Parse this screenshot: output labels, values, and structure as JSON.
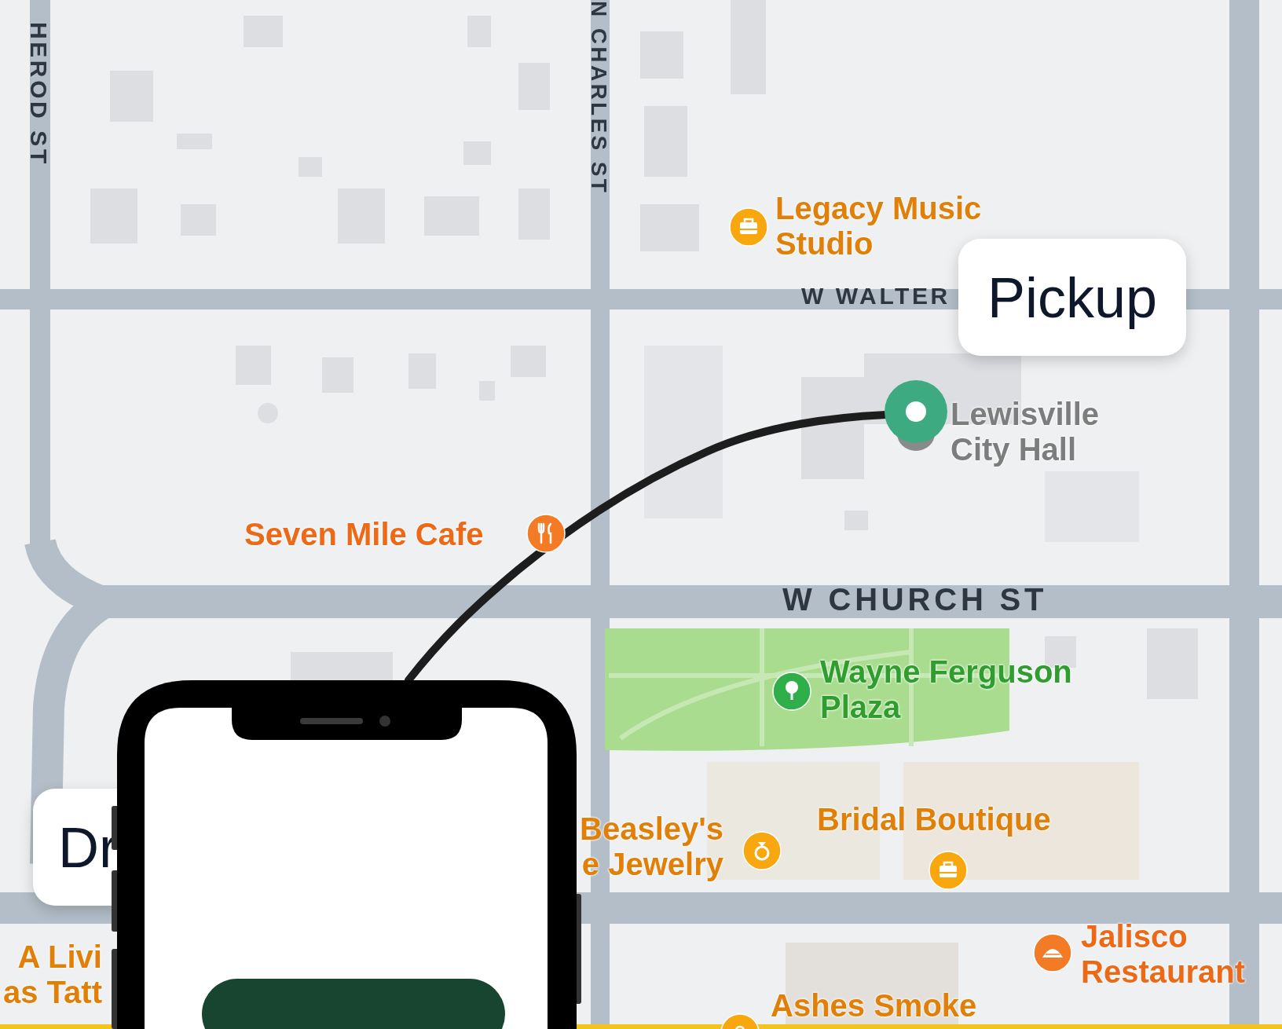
{
  "streets": [
    {
      "label": "HEROD ST",
      "kind": "vertical"
    },
    {
      "label": "N CHARLES ST",
      "kind": "vertical"
    },
    {
      "label": "W WALTER",
      "kind": "horizontal"
    },
    {
      "label": "W CHURCH ST",
      "kind": "horizontal"
    }
  ],
  "places": [
    {
      "name": "Legacy Music\nStudio",
      "kind": "shop"
    },
    {
      "name": "Seven Mile Cafe",
      "kind": "cafe"
    },
    {
      "name": "Lewisville\nCity Hall",
      "kind": "landmark"
    },
    {
      "name": "Wayne Ferguson\nPlaza",
      "kind": "park"
    },
    {
      "name": "Beasley's\ne Jewelry",
      "kind": "jewelry"
    },
    {
      "name": "Bridal Boutique",
      "kind": "shop"
    },
    {
      "name": "Jalisco\nRestaurant",
      "kind": "restaurant"
    },
    {
      "name": "Ashes Smoke",
      "kind": "smoke"
    },
    {
      "name": "A Livi\nas Tatt",
      "kind": "plain"
    }
  ],
  "route": {
    "pickup_label": "Pickup",
    "dropoff_label": "Dr"
  }
}
